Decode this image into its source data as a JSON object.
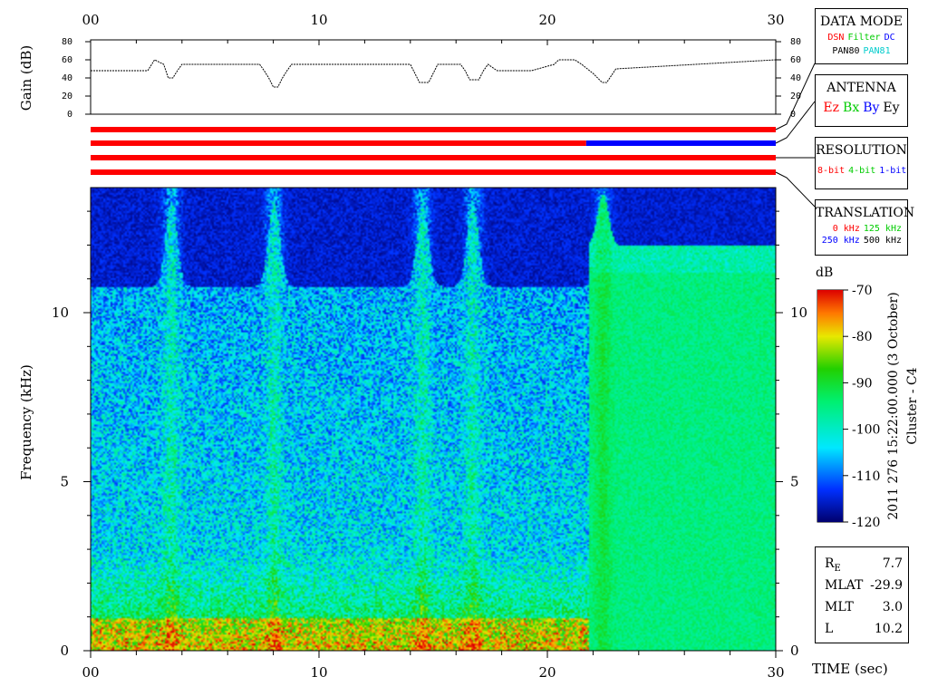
{
  "chart_data": {
    "type": "heatmap",
    "mission": "Cluster - C4",
    "timestamp": "2011 276 15:22:00.000 (3 October)",
    "x_ticks": [
      "00",
      "10",
      "20",
      "30"
    ],
    "xlabel": "TIME (sec)",
    "xlim": [
      0,
      30
    ],
    "gain_panel": {
      "ylabel": "Gain (dB)",
      "ylim": [
        0,
        80
      ],
      "y_ticks": [
        "80",
        "60",
        "40",
        "20",
        "0"
      ],
      "profile_t": [
        0,
        2.5,
        2.8,
        3.2,
        3.4,
        3.6,
        3.8,
        4.0,
        4.2,
        7.4,
        7.6,
        7.8,
        8.0,
        8.2,
        8.4,
        8.6,
        8.8,
        14.0,
        14.2,
        14.4,
        14.8,
        15.0,
        15.2,
        16.2,
        16.4,
        16.6,
        17.0,
        17.2,
        17.4,
        17.8,
        19.3,
        20.3,
        20.5,
        21.2,
        21.5,
        22.0,
        22.4,
        22.6,
        23.0,
        30
      ],
      "profile_db": [
        48,
        48,
        60,
        55,
        40,
        40,
        48,
        55,
        55,
        55,
        48,
        40,
        30,
        30,
        40,
        48,
        55,
        55,
        45,
        35,
        35,
        45,
        55,
        55,
        48,
        38,
        38,
        48,
        55,
        48,
        48,
        55,
        60,
        60,
        55,
        45,
        35,
        35,
        50,
        60
      ]
    },
    "channel_bars": [
      {
        "segments": [
          {
            "t0": 0,
            "t1": 30,
            "color": "#ff0000"
          }
        ]
      },
      {
        "segments": [
          {
            "t0": 0,
            "t1": 21.7,
            "color": "#ff0000"
          },
          {
            "t0": 21.7,
            "t1": 30,
            "color": "#0000ff"
          }
        ]
      },
      {
        "segments": [
          {
            "t0": 0,
            "t1": 30,
            "color": "#ff0000"
          }
        ]
      },
      {
        "segments": [
          {
            "t0": 0,
            "t1": 30,
            "color": "#ff0000"
          }
        ]
      }
    ],
    "spectrogram": {
      "ylabel": "Frequency (kHz)",
      "ylim": [
        0,
        13.7
      ],
      "y_ticks": [
        "0",
        "5",
        "10"
      ],
      "mode_switch_t": 21.8,
      "burst_t": [
        3.5,
        8.0,
        14.5,
        16.7,
        22.4
      ],
      "cutoff_khz_before": 10.8,
      "cutoff_khz_after": 12.0
    },
    "colorbar": {
      "label": "dB",
      "range": [
        -120,
        -70
      ],
      "ticks": [
        "-70",
        "-80",
        "-90",
        "-100",
        "-110",
        "-120"
      ]
    }
  },
  "legend_boxes": {
    "data_mode": {
      "title": "DATA MODE",
      "row1": [
        {
          "t": "DSN",
          "c": "#ff0000"
        },
        {
          "t": "Filter",
          "c": "#00cc00"
        },
        {
          "t": "DC",
          "c": "#0000ff"
        }
      ],
      "row2": [
        {
          "t": "PAN80",
          "c": "#000000"
        },
        {
          "t": "PAN81",
          "c": "#00cccc"
        }
      ]
    },
    "antenna": {
      "title": "ANTENNA",
      "row1": [
        {
          "t": "Ez",
          "c": "#ff0000"
        },
        {
          "t": "Bx",
          "c": "#00cc00"
        },
        {
          "t": "By",
          "c": "#0000ff"
        },
        {
          "t": "Ey",
          "c": "#000000"
        }
      ]
    },
    "resolution": {
      "title": "RESOLUTION",
      "row1": [
        {
          "t": "8-bit",
          "c": "#ff0000"
        },
        {
          "t": "4-bit",
          "c": "#00cc00"
        },
        {
          "t": "1-bit",
          "c": "#0000ff"
        }
      ]
    },
    "translation": {
      "title": "TRANSLATION",
      "row1": [
        {
          "t": "0 kHz",
          "c": "#ff0000"
        },
        {
          "t": "125 kHz",
          "c": "#00cc00"
        }
      ],
      "row2": [
        {
          "t": "250 kHz",
          "c": "#0000ff"
        },
        {
          "t": "500 kHz",
          "c": "#000000"
        }
      ]
    }
  },
  "orbit_info": [
    {
      "label": "R_E",
      "value": "7.7"
    },
    {
      "label": "MLAT",
      "value": "-29.9"
    },
    {
      "label": "MLT",
      "value": "3.0"
    },
    {
      "label": "L",
      "value": "10.2"
    }
  ]
}
